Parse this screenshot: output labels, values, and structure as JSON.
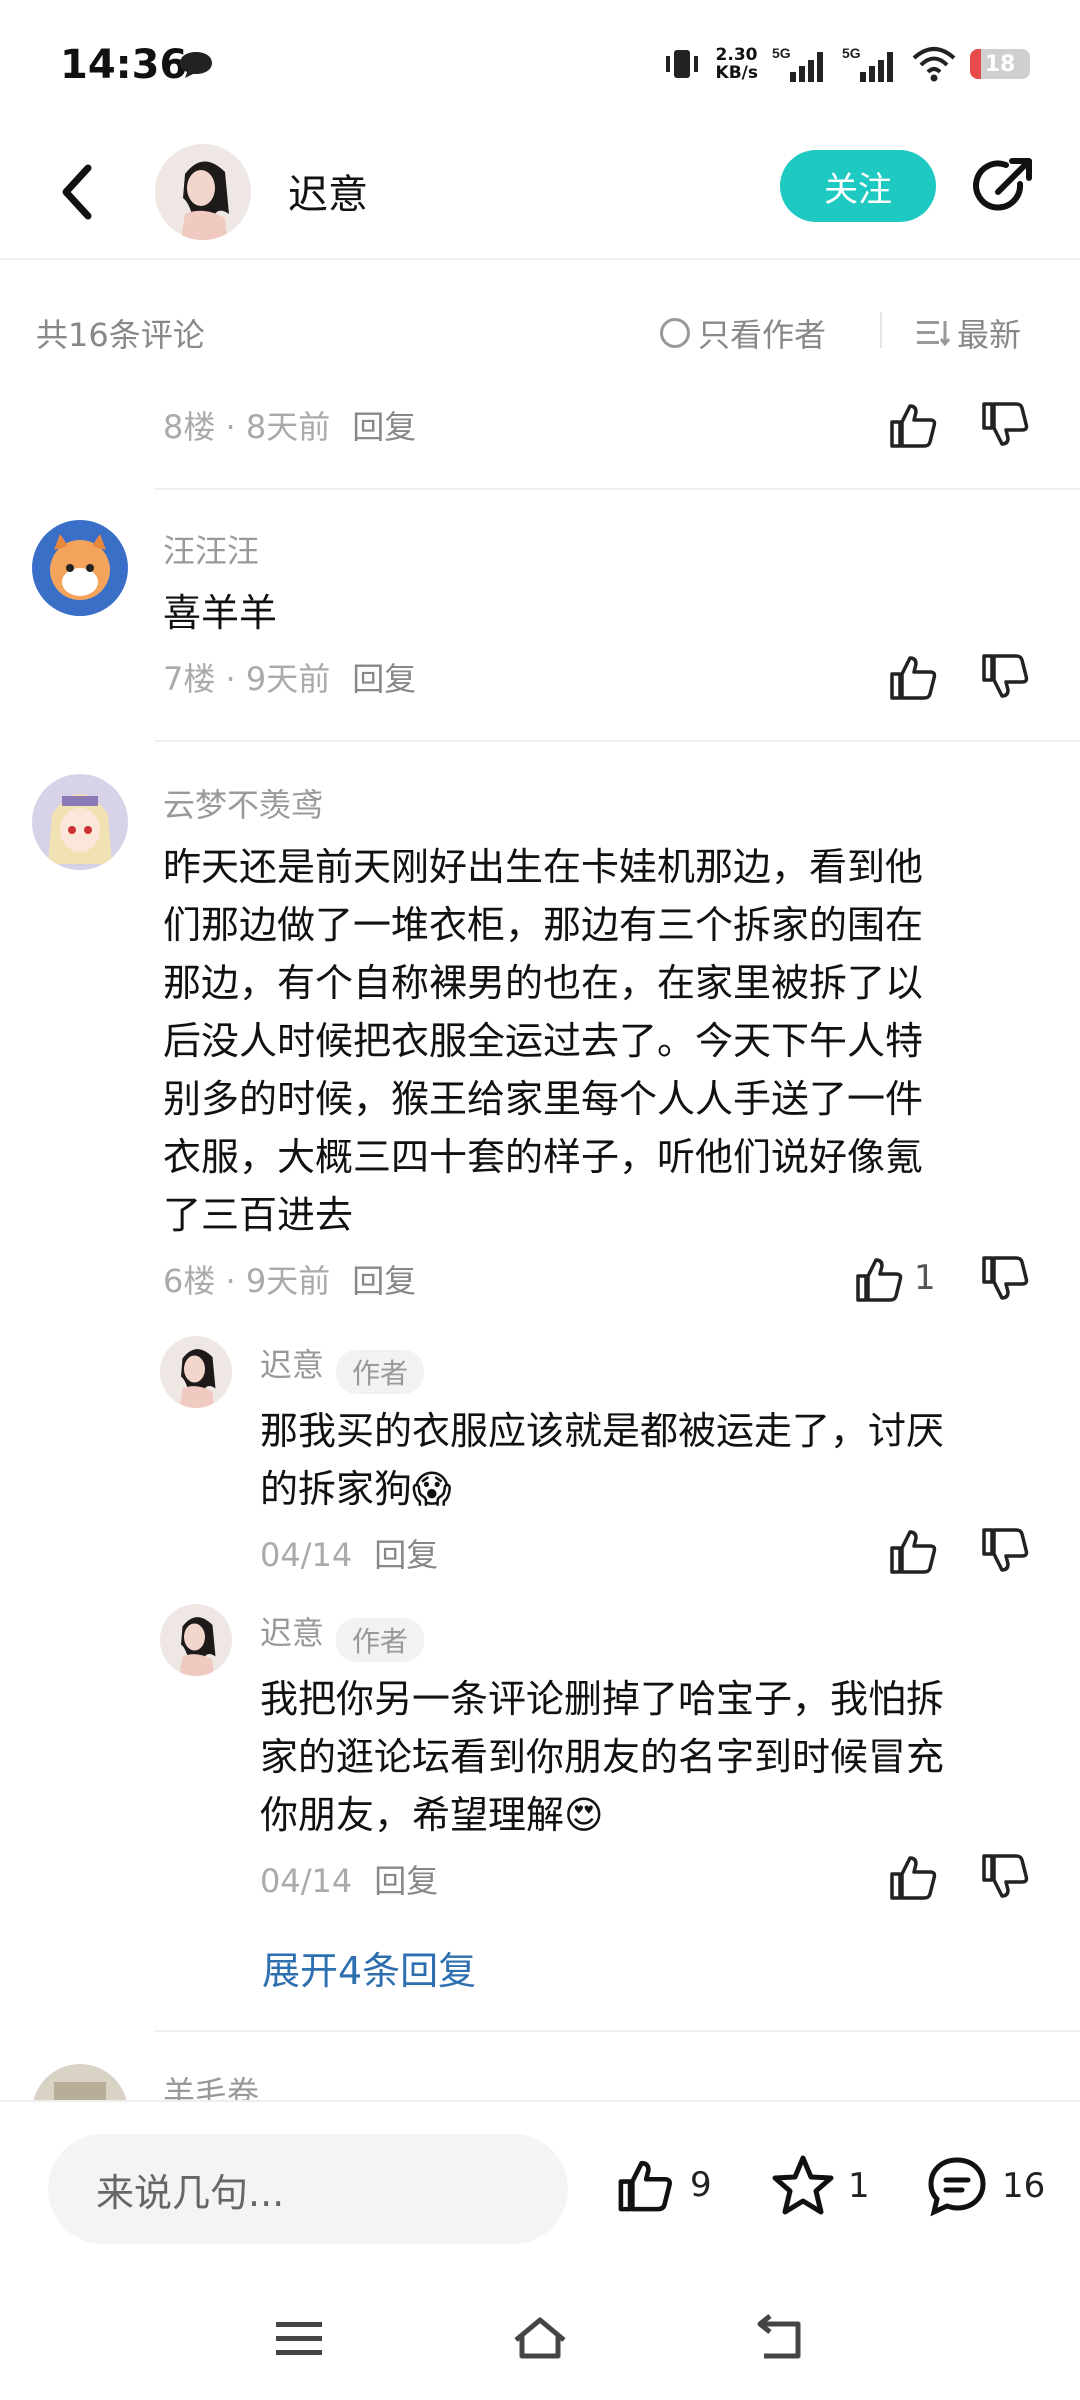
{
  "status": {
    "time": "14:36",
    "net_speed_value": "2.30",
    "net_speed_unit": "KB/s",
    "signal_1": "5G",
    "signal_2": "5G",
    "battery": "18",
    "battery_level": 0.18
  },
  "header": {
    "author": "迟意",
    "follow_label": "关注"
  },
  "sortbar": {
    "count": "共16条评论",
    "only_author": "只看作者",
    "newest": "最新"
  },
  "comments": [
    {
      "meta_floor": "8楼 · 8天前",
      "reply": "回复"
    },
    {
      "user": "汪汪汪",
      "text": "喜羊羊",
      "meta_floor": "7楼 · 9天前",
      "reply": "回复"
    },
    {
      "user": "云梦不羡鸢",
      "lines": [
        "昨天还是前天刚好出生在卡娃机那边，看到他",
        "们那边做了一堆衣柜，那边有三个拆家的围在",
        "那边，有个自称裸男的也在，在家里被拆了以",
        "后没人时候把衣服全运过去了。今天下午人特",
        "别多的时候，猴王给家里每个人人手送了一件",
        "衣服，大概三四十套的样子，听他们说好像氪",
        "了三百进去"
      ],
      "meta_floor": "6楼 · 9天前",
      "reply": "回复",
      "likes": "1",
      "replies": [
        {
          "user": "迟意",
          "tag": "作者",
          "lines": [
            "那我买的衣服应该就是都被运走了，讨厌",
            "的拆家狗😱"
          ],
          "date": "04/14",
          "reply": "回复"
        },
        {
          "user": "迟意",
          "tag": "作者",
          "lines": [
            "我把你另一条评论删掉了哈宝子，我怕拆",
            "家的逛论坛看到你朋友的名字到时候冒充",
            "你朋友，希望理解😍"
          ],
          "date": "04/14",
          "reply": "回复"
        }
      ],
      "expand": "展开4条回复"
    },
    {
      "user": "羊毛卷"
    }
  ],
  "bottom": {
    "placeholder": "来说几句...",
    "likes": "9",
    "favorites": "1",
    "comments": "16"
  },
  "colors": {
    "accent": "#1ec9c2",
    "link": "#2e6fb0",
    "battery_low": "#e84b4b"
  }
}
